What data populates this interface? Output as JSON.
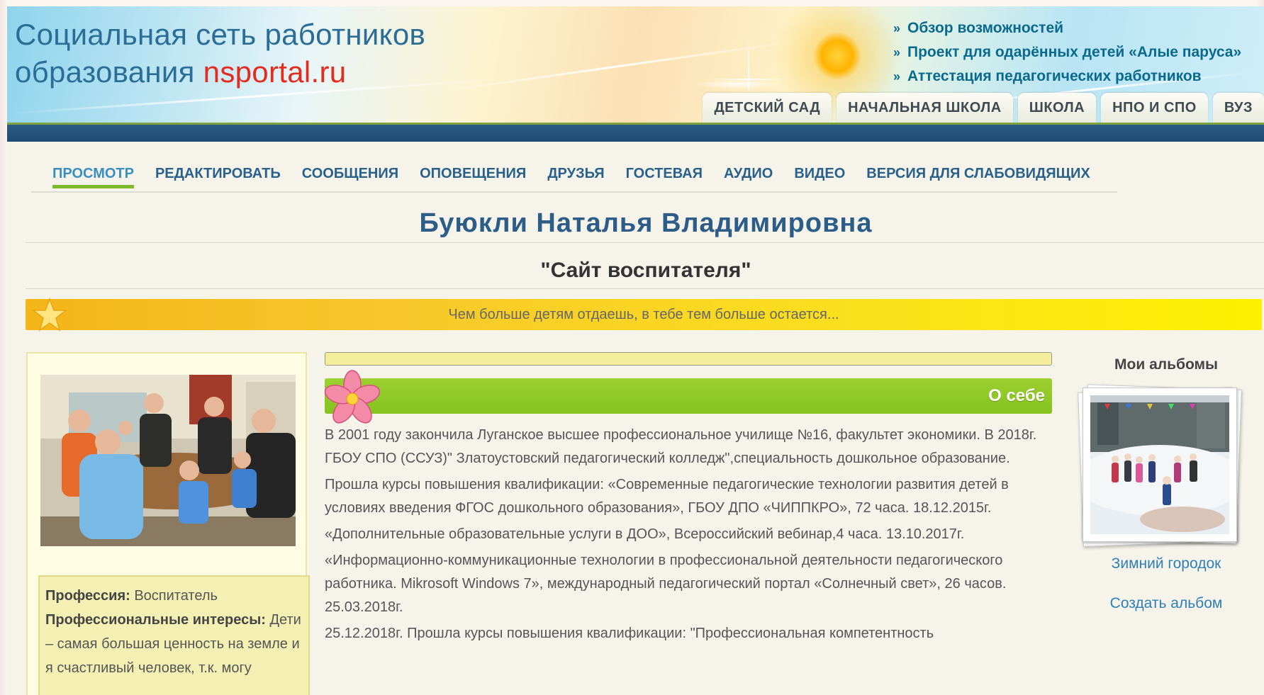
{
  "header": {
    "title_line1": "Социальная сеть работников",
    "title_line2_prefix": "образования ",
    "title_brand": "nsportal.ru",
    "top_links": [
      {
        "mark": "»",
        "label": "Обзор возможностей"
      },
      {
        "mark": "»",
        "label": "Проект для одарённых детей «Алые паруса»"
      },
      {
        "mark": "»",
        "label": "Аттестация педагогических работников"
      }
    ],
    "section_tabs": [
      "ДЕТСКИЙ САД",
      "НАЧАЛЬНАЯ ШКОЛА",
      "ШКОЛА",
      "НПО И СПО",
      "ВУЗ"
    ]
  },
  "nav": {
    "items": [
      "ПРОСМОТР",
      "РЕДАКТИРОВАТЬ",
      "СООБЩЕНИЯ",
      "ОПОВЕЩЕНИЯ",
      "ДРУЗЬЯ",
      "ГОСТЕВАЯ",
      "АУДИО",
      "ВИДЕО",
      "ВЕРСИЯ ДЛЯ СЛАБОВИДЯЩИХ"
    ],
    "active": "ПРОСМОТР"
  },
  "owner_name": "Буюкли Наталья Владимировна",
  "site_subtitle": "\"Сайт воспитателя\"",
  "motto": "Чем больше детям отдаешь, в тебе тем больше остается...",
  "profile": {
    "profession_label": "Профессия:",
    "profession_value": " Воспитатель",
    "interests_label": "Профессиональные интересы:",
    "interests_value": " Дети – самая большая ценность на земле и я счастливый человек, т.к. могу"
  },
  "about": {
    "title": "О себе",
    "paragraphs": [
      "В 2001 году закончила Луганское высшее профессиональное училище №16, факультет экономики. В 2018г. ГБОУ СПО (ССУЗ)\" Златоустовский педагогический колледж\",специальность дошкольное образование.",
      "Прошла курсы повышения квалификации: «Современные педагогические технологии развития детей в условиях введения ФГОС дошкольного образования», ГБОУ ДПО «ЧИППКРО», 72 часа. 18.12.2015г.",
      "«Дополнительные образовательные услуги в ДОО», Всероссийский вебинар,4 часа. 13.10.2017г.",
      "«Информационно-коммуникационные технологии в профессиональной деятельности педагогического работника. Mikrosoft Windows 7», международный педагогический портал «Солнечный свет», 26 часов. 25.03.2018г.",
      "25.12.2018г. Прошла курсы повышения квалификации: \"Профессиональная компетентность"
    ]
  },
  "albums": {
    "title": "Мои альбомы",
    "album_caption": "Зимний городок",
    "create_label": "Создать альбом"
  },
  "colors": {
    "brand_blue": "#2a6e98",
    "brand_red": "#e52b1e",
    "nav_blue": "#29618b",
    "accent_green": "#85c31f",
    "motto_yellow": "#fbe21b"
  }
}
